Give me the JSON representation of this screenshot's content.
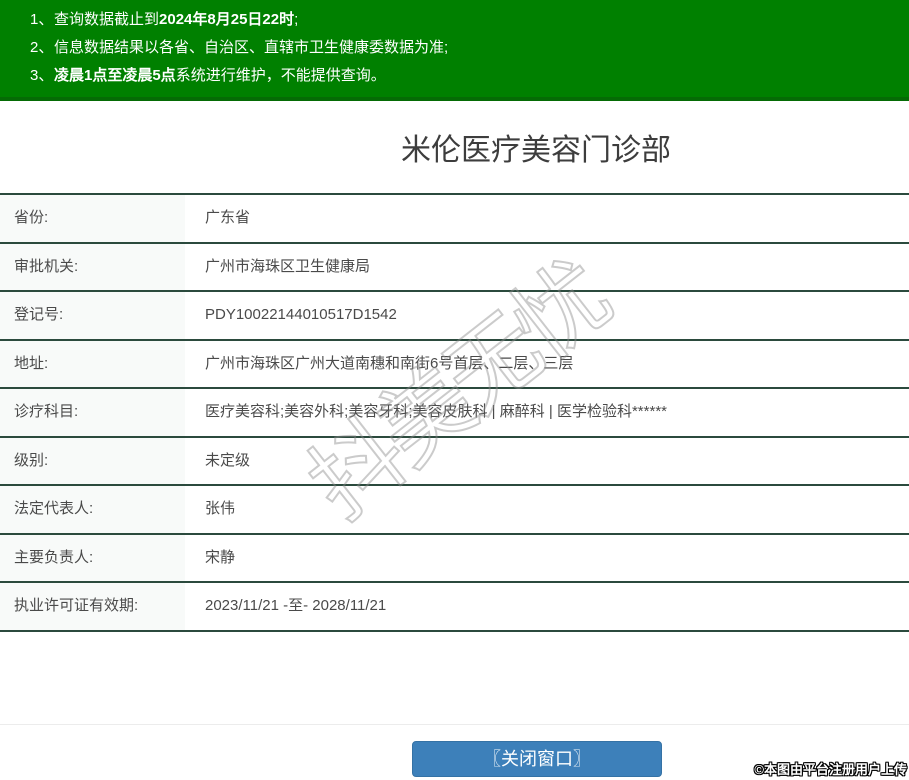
{
  "banner": {
    "notices": [
      {
        "num": "1、",
        "pre": "查询数据截止到",
        "bold": "2024年8月25日22时",
        "post": ";"
      },
      {
        "num": "2、",
        "pre": "信息数据结果以各省、自治区、直辖市卫生健康委数据为准;",
        "bold": "",
        "post": ""
      },
      {
        "num": "3、",
        "pre": "",
        "bold": "凌晨1点至凌晨5点",
        "post": "系统进行维护，不能提供查询。"
      }
    ]
  },
  "page": {
    "title": "米伦医疗美容门诊部"
  },
  "details": {
    "rows": [
      {
        "label": "省份:",
        "value": "广东省"
      },
      {
        "label": "审批机关:",
        "value": "广州市海珠区卫生健康局"
      },
      {
        "label": "登记号:",
        "value": "PDY10022144010517D1542"
      },
      {
        "label": "地址:",
        "value": "广州市海珠区广州大道南穗和南街6号首层、二层、三层"
      },
      {
        "label": "诊疗科目:",
        "value": "医疗美容科;美容外科;美容牙科;美容皮肤科 | 麻醉科 | 医学检验科******"
      },
      {
        "label": "级别:",
        "value": "未定级"
      },
      {
        "label": "法定代表人:",
        "value": "张伟"
      },
      {
        "label": "主要负责人:",
        "value": "宋静"
      },
      {
        "label": "执业许可证有效期:",
        "value": "2023/11/21 -至- 2028/11/21"
      }
    ]
  },
  "watermark": {
    "text": "抖美无忧"
  },
  "footer": {
    "close_button_label": "〖关闭窗口〗",
    "copyright": "©本图由平台注册用户上传"
  },
  "colors": {
    "banner_green": "#008000",
    "banner_border_green": "#056b05",
    "table_border_green": "#2b4a3d",
    "label_cell_bg": "#f8faf9",
    "button_blue": "#3d80ba",
    "text_dark": "#4a4a4a"
  }
}
